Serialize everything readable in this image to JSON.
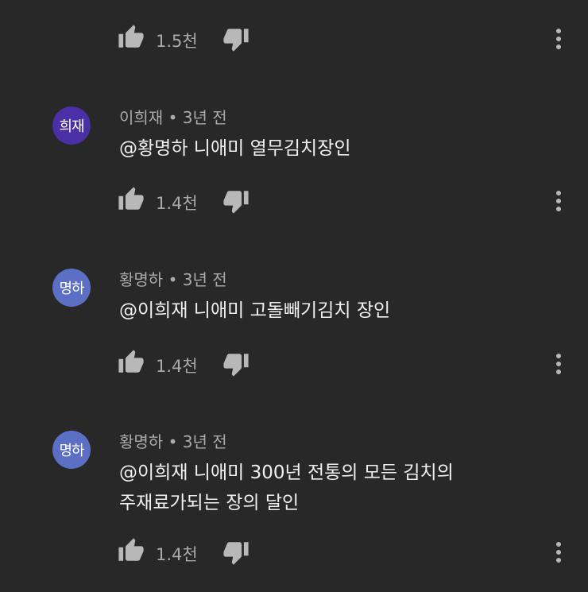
{
  "top_actions": {
    "like_count": "1.5천"
  },
  "comments": [
    {
      "avatar_text": "희재",
      "avatar_color": "#4a2fa6",
      "author": "이희재",
      "separator": "•",
      "time": "3년 전",
      "lines": [
        "@황명하 니애미 열무김치장인"
      ],
      "like_count": "1.4천"
    },
    {
      "avatar_text": "명하",
      "avatar_color": "#5b6fc4",
      "author": "황명하",
      "separator": "•",
      "time": "3년 전",
      "lines": [
        "@이희재 니애미 고돌빼기김치 장인"
      ],
      "like_count": "1.4천"
    },
    {
      "avatar_text": "명하",
      "avatar_color": "#5b6fc4",
      "author": "황명하",
      "separator": "•",
      "time": "3년 전",
      "lines": [
        "@이희재 니애미 300년 전통의 모든 김치의",
        "주재료가되는 장의 달인"
      ],
      "like_count": "1.4천"
    }
  ]
}
